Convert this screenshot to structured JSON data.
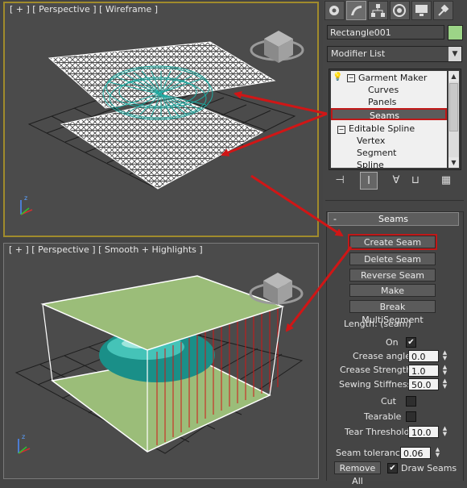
{
  "viewports": {
    "top_label": "[ + ] [ Perspective ] [ Wireframe ]",
    "bottom_label": "[ + ] [ Perspective ] [ Smooth + Highlights ]"
  },
  "command_panel": {
    "tabs": [
      "create-icon",
      "modify-icon",
      "hierarchy-icon",
      "motion-icon",
      "display-icon",
      "utilities-icon"
    ],
    "object_name": "Rectangle001",
    "object_color": "#9cd487",
    "modifier_list": "Modifier List",
    "stack": {
      "items": [
        {
          "label": "Garment Maker"
        },
        {
          "label": "Curves"
        },
        {
          "label": "Panels"
        },
        {
          "label": "Seams"
        },
        {
          "label": "Editable Spline"
        },
        {
          "label": "Vertex"
        },
        {
          "label": "Segment"
        },
        {
          "label": "Spline"
        }
      ],
      "selected": "Seams"
    },
    "stack_tools": [
      "pin-stack-icon",
      "show-end-result-icon",
      "make-unique-icon",
      "remove-modifier-icon",
      "configure-sets-icon"
    ]
  },
  "seams_rollout": {
    "title": "Seams",
    "buttons": {
      "create_seam": "Create Seam",
      "delete_seam": "Delete Seam",
      "reverse_seam": "Reverse Seam",
      "make_multisegment": "Make MultiSegment",
      "break_multisegment": "Break MultiSegment"
    },
    "length_label": "Length: (seam)",
    "on_label": "On",
    "on_checked": true,
    "crease_angle_label": "Crease angle",
    "crease_angle": "0.0",
    "crease_strength_label": "Crease Strength",
    "crease_strength": "1.0",
    "sewing_stiffness_label": "Sewing Stiffness",
    "sewing_stiffness": "50.0",
    "cut_label": "Cut",
    "cut_checked": false,
    "tearable_label": "Tearable",
    "tearable_checked": false,
    "tear_threshold_label": "Tear Threshold",
    "tear_threshold": "10.0",
    "seam_tolerance_label": "Seam tolerance",
    "seam_tolerance": "0.06",
    "remove_all": "Remove All",
    "draw_seams_label": "Draw Seams",
    "draw_seams_checked": true
  },
  "colors": {
    "highlight": "#c01818",
    "cloth_top": "#9bbd79",
    "teal": "#1fa9a0"
  }
}
